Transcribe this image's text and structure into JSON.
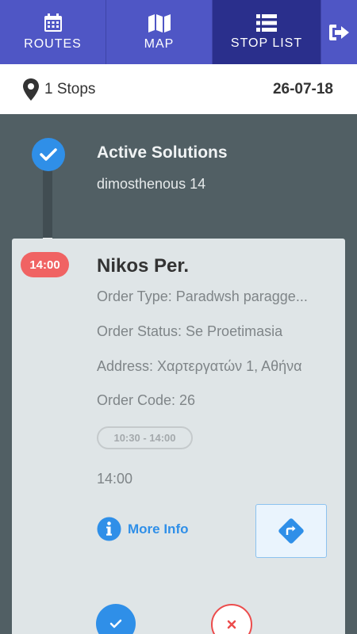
{
  "nav": {
    "tabs": [
      {
        "label": "ROUTES",
        "icon": "calendar-icon",
        "active": false
      },
      {
        "label": "MAP",
        "icon": "map-icon",
        "active": false
      },
      {
        "label": "STOP LIST",
        "icon": "list-icon",
        "active": true
      }
    ],
    "logout_icon": "logout-icon"
  },
  "info": {
    "stops_label": "1 Stops",
    "date": "26-07-18"
  },
  "solution": {
    "title": "Active Solutions",
    "address": "dimosthenous 14"
  },
  "stop": {
    "time_badge": "14:00",
    "name": "Nikos Per.",
    "order_type": "Order Type: Paradwsh paragge...",
    "order_status": "Order Status: Se Proetimasia",
    "address": "Address: Χαρτεργατών 1, Αθήνα",
    "order_code": "Order Code: 26",
    "time_window": "10:30 - 14:00",
    "time": "14:00",
    "more_info": "More Info"
  },
  "colors": {
    "nav": "#4f56c5",
    "nav_active": "#2a2f8c",
    "background": "#515f64",
    "card": "#dfe5e7",
    "accent": "#2f8fe8",
    "danger": "#f06363"
  }
}
